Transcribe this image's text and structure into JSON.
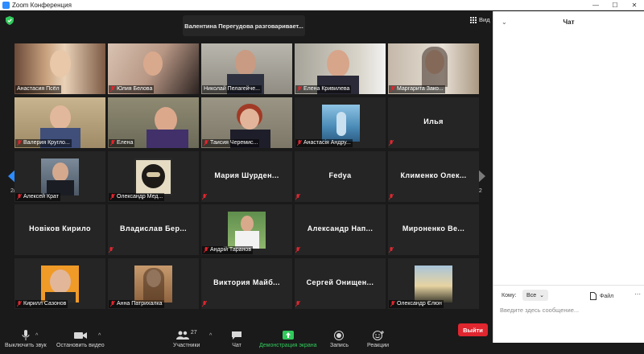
{
  "window": {
    "title": "Zoom Конференция"
  },
  "banner": {
    "speaking": "Валентина Перегудова разговаривает..."
  },
  "view": {
    "label": "Вид"
  },
  "pagination": {
    "left": "2/2",
    "right": "2/2"
  },
  "participants": [
    {
      "name": "Анастасия Псёл",
      "video": true,
      "muted": false
    },
    {
      "name": "Юлия Белова",
      "video": true,
      "muted": true
    },
    {
      "name": "Николай Пелагейче...",
      "video": true,
      "muted": false
    },
    {
      "name": "Елена Кривилева",
      "video": true,
      "muted": true
    },
    {
      "name": "Маргарита Зако...",
      "video": true,
      "muted": true
    },
    {
      "name": "Валерия Кругло...",
      "video": true,
      "muted": true
    },
    {
      "name": "Елена",
      "video": true,
      "muted": true
    },
    {
      "name": "Таисия Черемис...",
      "video": true,
      "muted": true
    },
    {
      "name": "Анастасія Андру...",
      "video": true,
      "muted": true
    },
    {
      "name": "Илья",
      "video": false,
      "muted": true
    },
    {
      "name": "Алексей Крат",
      "video": true,
      "muted": true
    },
    {
      "name": "Олександр Мед...",
      "video": true,
      "muted": true
    },
    {
      "name": "Мария Шурден...",
      "video": false,
      "muted": true
    },
    {
      "name": "Fedya",
      "video": false,
      "muted": true
    },
    {
      "name": "Клименко Олек...",
      "video": false,
      "muted": true
    },
    {
      "name": "Новіков Кирило",
      "video": false,
      "muted": false
    },
    {
      "name": "Владислав Бер...",
      "video": false,
      "muted": true
    },
    {
      "name": "Андрій Таранов",
      "video": true,
      "muted": true
    },
    {
      "name": "Александр Нап...",
      "video": false,
      "muted": true
    },
    {
      "name": "Мироненко Ве...",
      "video": false,
      "muted": true
    },
    {
      "name": "Кирилл Сазонов",
      "video": true,
      "muted": true
    },
    {
      "name": "Анна Патрихалка",
      "video": true,
      "muted": true
    },
    {
      "name": "Виктория Майб...",
      "video": false,
      "muted": true
    },
    {
      "name": "Сергей Онищен...",
      "video": false,
      "muted": true
    },
    {
      "name": "Олександр Єлюн",
      "video": true,
      "muted": true
    }
  ],
  "toolbar": {
    "mute": "Выключить звук",
    "video": "Остановить видео",
    "participants": "Участники",
    "participants_count": "27",
    "chat": "Чат",
    "share": "Демонстрация экрана",
    "record": "Запись",
    "reactions": "Реакции",
    "leave": "Выйти"
  },
  "chat": {
    "title": "Чат",
    "to_label": "Кому:",
    "to_value": "Все",
    "file": "Файл",
    "placeholder": "Введите здесь сообщение..."
  },
  "colors": {
    "accent": "#2d8cff",
    "leave": "#e0262f",
    "share": "#31c95b",
    "muted": "#e0262f"
  }
}
